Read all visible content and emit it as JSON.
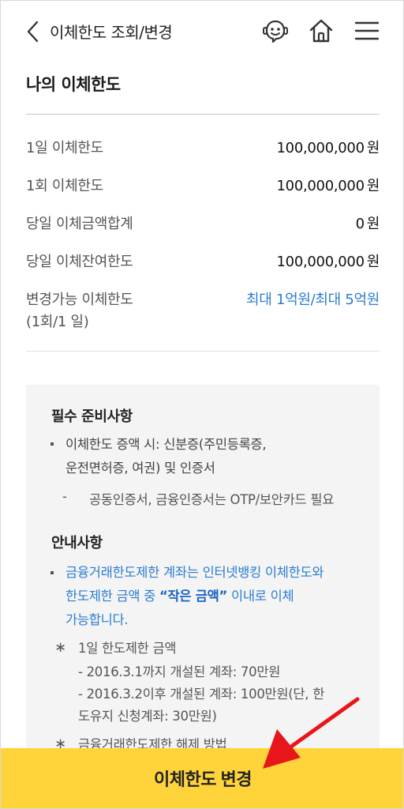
{
  "header": {
    "title": "이체한도 조회/변경",
    "icons": [
      "chevron-left-icon",
      "chatbot-icon",
      "home-icon",
      "menu-icon"
    ]
  },
  "limits": {
    "section_title": "나의 이체한도",
    "rows": [
      {
        "label": "1일 이체한도",
        "value": "100,000,000",
        "unit": "원"
      },
      {
        "label": "1회 이체한도",
        "value": "100,000,000",
        "unit": "원"
      },
      {
        "label": "당일 이체금액합계",
        "value": "0",
        "unit": "원"
      },
      {
        "label": "당일 이체잔여한도",
        "value": "100,000,000",
        "unit": "원"
      }
    ],
    "changeable": {
      "label_line1": "변경가능 이체한도",
      "label_line2": "(1회/1 일)",
      "value": "최대 1억원/최대 5억원"
    }
  },
  "info": {
    "required_title": "필수 준비사항",
    "required_item_line1": "이체한도 증액 시: 신분증(주민등록증,",
    "required_item_line2": "운전면허증, 여권) 및 인증서",
    "required_sub": "공동인증서, 금융인증서는 OTP/보안카드 필요",
    "notice_title": "안내사항",
    "notice_line1": "금융거래한도제한 계좌는 인터넷뱅킹 이체한도와",
    "notice_line2_pre": "한도제한 금액 중 ",
    "notice_line2_bold": "“작은 금액”",
    "notice_line2_post": " 이내로 이체",
    "notice_line3": "가능합니다.",
    "star1_title": "1일 한도제한 금액",
    "star1_sub1": "- 2016.3.1까지 개설된 계좌: 70만원",
    "star1_sub2": "- 2016.3.2이후 개설된 계좌: 100만원(단, 한",
    "star1_sub3": "도유지 신청계좌: 30만원)",
    "star2_title": "금융거래한도제한 해제 방법",
    "star_symbol": "∗",
    "dash_symbol": "-"
  },
  "cta": {
    "label": "이체한도 변경"
  },
  "colors": {
    "accent_yellow": "#ffd43b",
    "link_blue": "#2a7dd1",
    "annotation_red": "#e8161b"
  }
}
